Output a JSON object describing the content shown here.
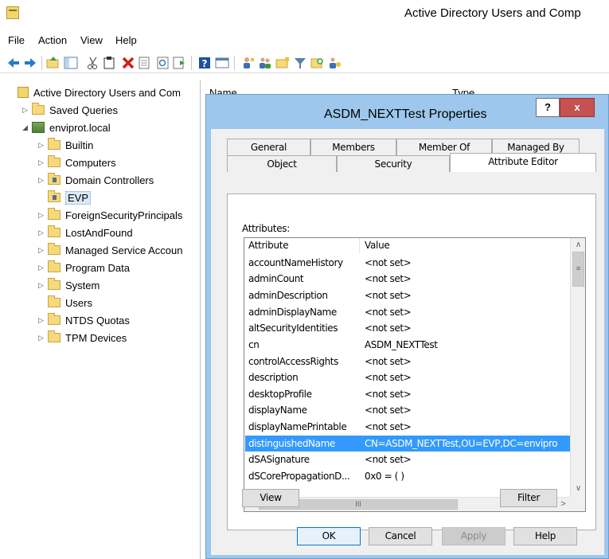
{
  "main_window": {
    "title": "Active Directory Users and Comp",
    "menu": [
      "File",
      "Action",
      "View",
      "Help"
    ],
    "toolbar_icons": [
      "back-icon",
      "forward-icon",
      "up-folder-icon",
      "show-tree-icon",
      "cut-icon",
      "copy-icon",
      "delete-icon",
      "properties-icon",
      "refresh-icon",
      "export-list-icon",
      "help-icon",
      "console-icon",
      "add-user-icon",
      "add-group-icon",
      "add-ou-icon",
      "filter-icon",
      "find-icon",
      "delegate-icon"
    ]
  },
  "tree": {
    "root": "Active Directory Users and Com",
    "items": [
      {
        "label": "Saved Queries",
        "level": 1,
        "expander": "closed"
      },
      {
        "label": "enviprot.local",
        "level": 1,
        "expander": "open"
      },
      {
        "label": "Builtin",
        "level": 2,
        "expander": "closed"
      },
      {
        "label": "Computers",
        "level": 2,
        "expander": "closed"
      },
      {
        "label": "Domain Controllers",
        "level": 2,
        "expander": "closed"
      },
      {
        "label": "EVP",
        "level": 2,
        "expander": "none",
        "selected": true
      },
      {
        "label": "ForeignSecurityPrincipals",
        "level": 2,
        "expander": "closed"
      },
      {
        "label": "LostAndFound",
        "level": 2,
        "expander": "closed"
      },
      {
        "label": "Managed Service Accoun",
        "level": 2,
        "expander": "closed"
      },
      {
        "label": "Program Data",
        "level": 2,
        "expander": "closed"
      },
      {
        "label": "System",
        "level": 2,
        "expander": "closed"
      },
      {
        "label": "Users",
        "level": 2,
        "expander": "none"
      },
      {
        "label": "NTDS Quotas",
        "level": 2,
        "expander": "closed"
      },
      {
        "label": "TPM Devices",
        "level": 2,
        "expander": "closed"
      }
    ]
  },
  "list_header": {
    "name": "Name",
    "type": "Type"
  },
  "dialog": {
    "title": "ASDM_NEXTTest Properties",
    "help_glyph": "?",
    "close_glyph": "x",
    "tabs_row1": [
      "General",
      "Members",
      "Member Of",
      "Managed By"
    ],
    "tabs_row2": [
      "Object",
      "Security",
      "Attribute Editor"
    ],
    "attributes_label": "Attributes:",
    "columns": {
      "attribute": "Attribute",
      "value": "Value"
    },
    "rows": [
      {
        "attr": "accountNameHistory",
        "value": "<not set>"
      },
      {
        "attr": "adminCount",
        "value": "<not set>"
      },
      {
        "attr": "adminDescription",
        "value": "<not set>"
      },
      {
        "attr": "adminDisplayName",
        "value": "<not set>"
      },
      {
        "attr": "altSecurityIdentities",
        "value": "<not set>"
      },
      {
        "attr": "cn",
        "value": "ASDM_NEXTTest"
      },
      {
        "attr": "controlAccessRights",
        "value": "<not set>"
      },
      {
        "attr": "description",
        "value": "<not set>"
      },
      {
        "attr": "desktopProfile",
        "value": "<not set>"
      },
      {
        "attr": "displayName",
        "value": "<not set>"
      },
      {
        "attr": "displayNamePrintable",
        "value": "<not set>"
      },
      {
        "attr": "distinguishedName",
        "value": "CN=ASDM_NEXTTest,OU=EVP,DC=envipro",
        "selected": true
      },
      {
        "attr": "dSASignature",
        "value": "<not set>"
      },
      {
        "attr": "dSCorePropagationD...",
        "value": "0x0 = ( )"
      }
    ],
    "scroll_glyphs": {
      "up": "∧",
      "down": "∨",
      "left": "<",
      "right": ">",
      "thumb_v": "≡",
      "thumb_h": "III"
    },
    "buttons": {
      "view": "View",
      "filter": "Filter",
      "ok": "OK",
      "cancel": "Cancel",
      "apply": "Apply",
      "help": "Help"
    }
  },
  "colors": {
    "dialog_frame": "#9dc7ec",
    "selection": "#3399ff",
    "close_button": "#c75050"
  }
}
